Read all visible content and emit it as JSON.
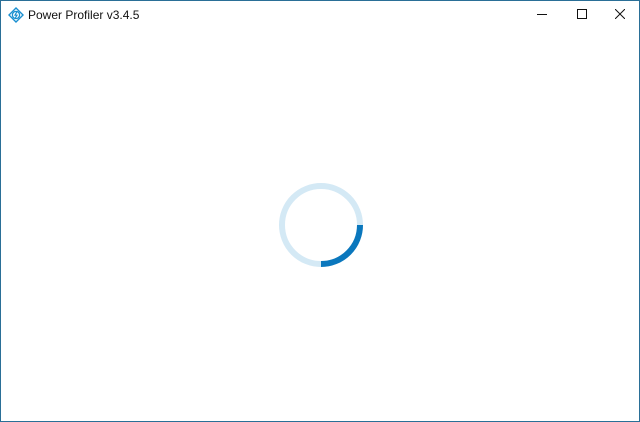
{
  "window": {
    "title": "Power Profiler v3.4.5",
    "app_icon": "power-profiler-logo-icon",
    "controls": {
      "minimize_icon": "minimize-icon",
      "maximize_icon": "maximize-icon",
      "close_icon": "close-icon"
    }
  },
  "loading": {
    "indicator": "loading-spinner",
    "progress_fraction": 0.25,
    "track_color": "#d4e9f5",
    "arc_color": "#0a77bd"
  },
  "colors": {
    "window_border": "#2a6f97",
    "background": "#ffffff"
  }
}
